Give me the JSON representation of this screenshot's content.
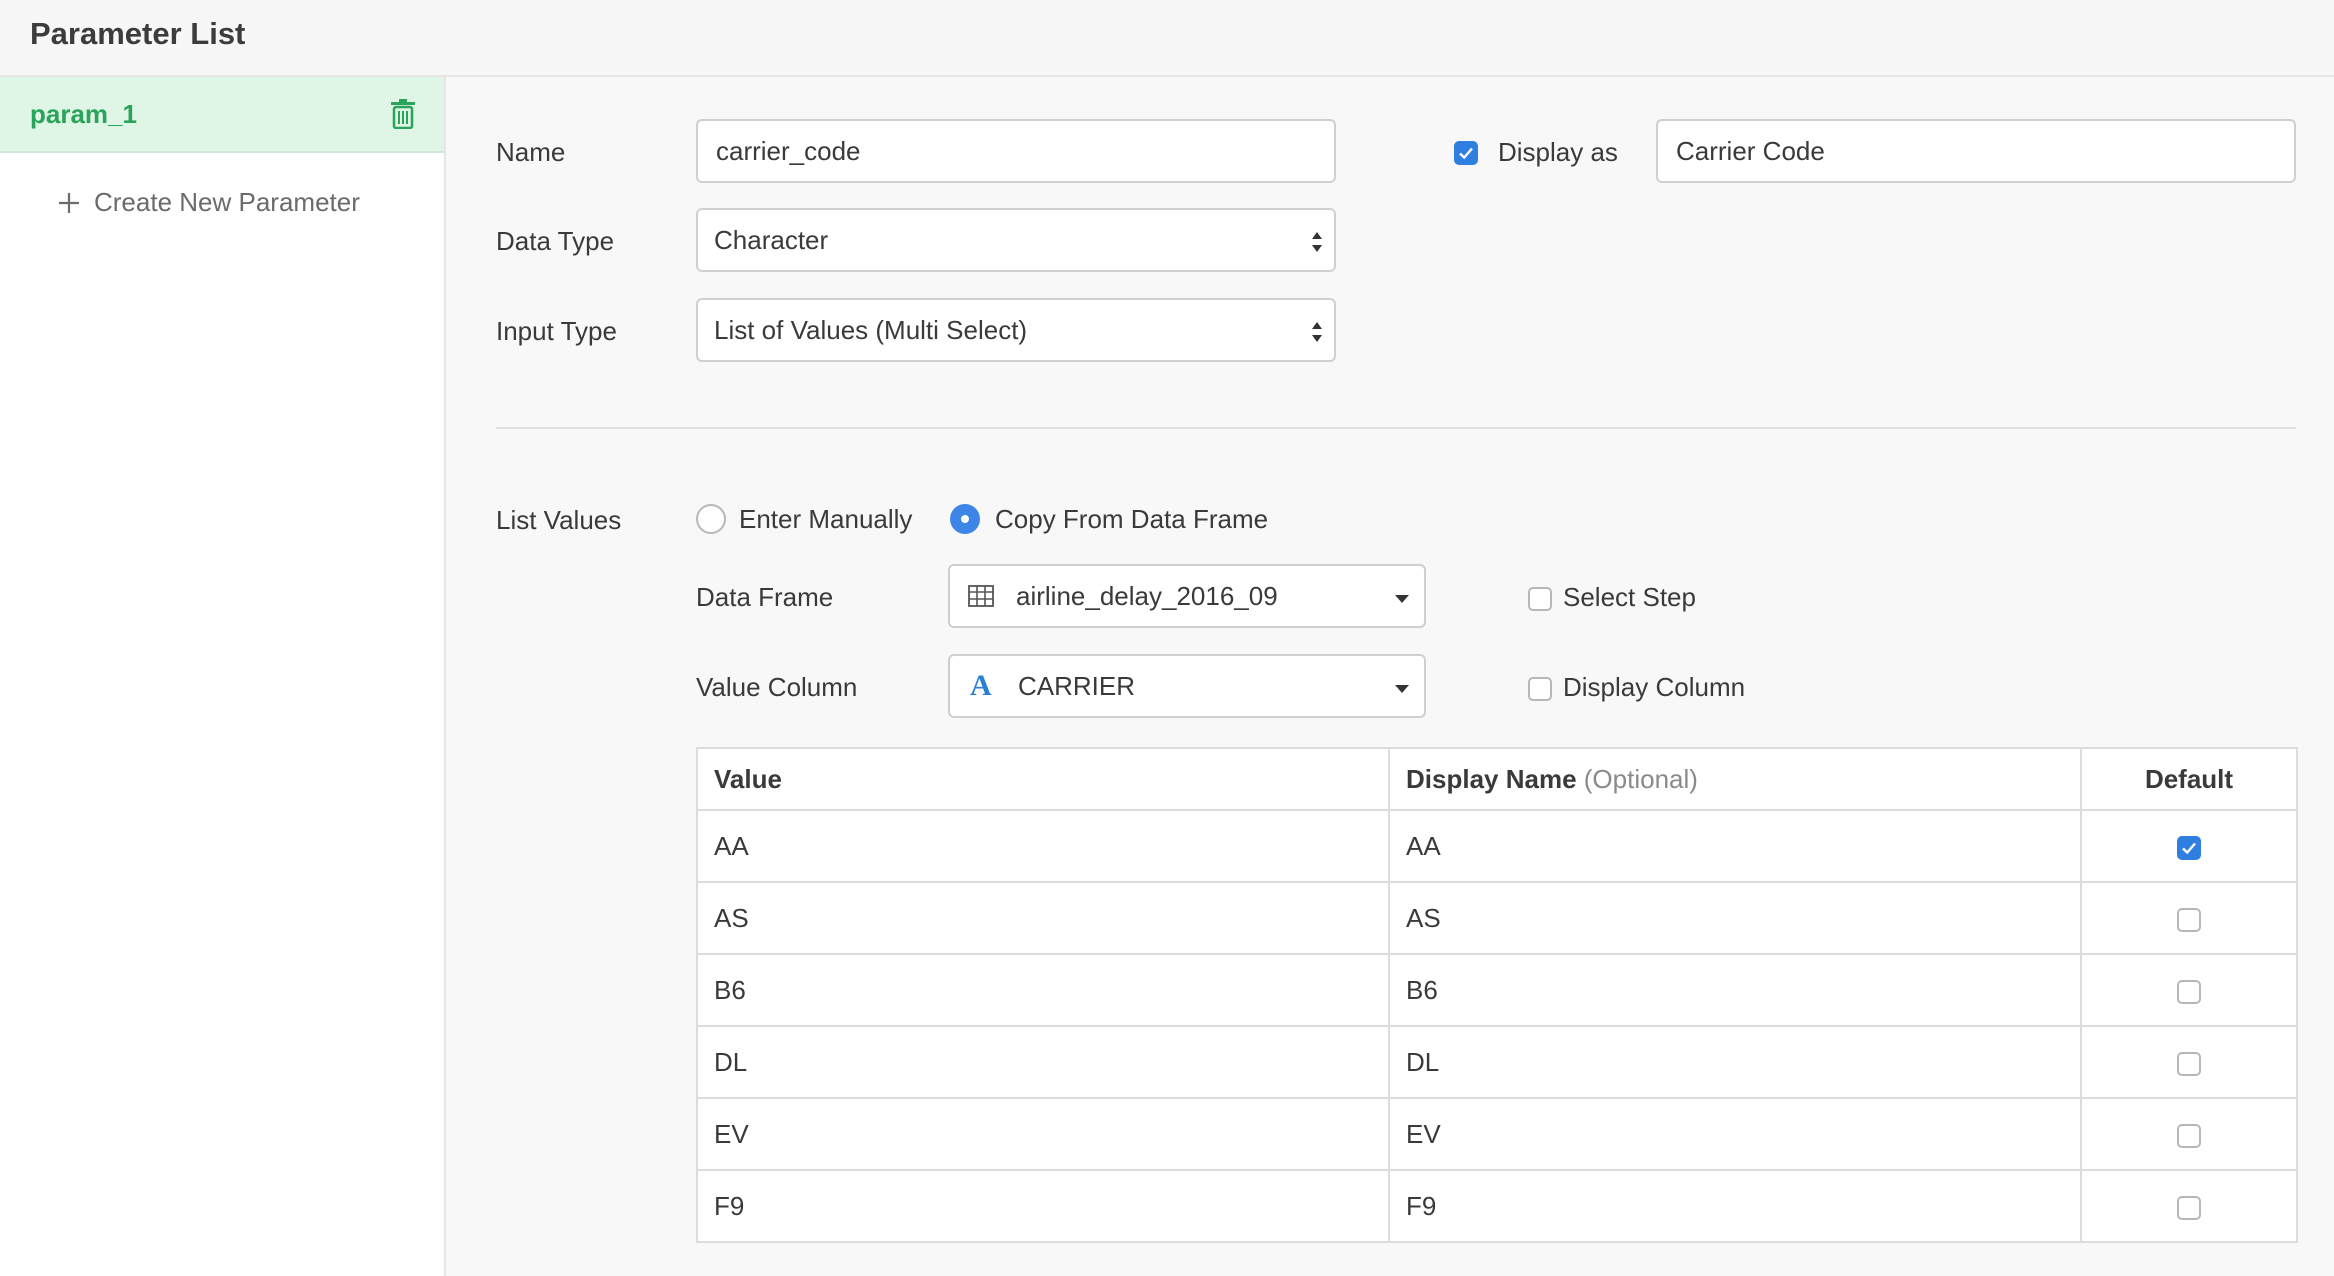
{
  "header": {
    "title": "Parameter List"
  },
  "sidebar": {
    "param_name": "param_1",
    "create_new_label": "Create New Parameter"
  },
  "form": {
    "name_label": "Name",
    "name_value": "carrier_code",
    "display_as_label": "Display as",
    "display_as_checked": true,
    "display_as_value": "Carrier Code",
    "data_type_label": "Data Type",
    "data_type_value": "Character",
    "input_type_label": "Input Type",
    "input_type_value": "List of Values (Multi Select)"
  },
  "list_values": {
    "label": "List Values",
    "option_manual": "Enter Manually",
    "option_copy": "Copy From Data Frame",
    "selected_option": "Copy From Data Frame",
    "data_frame_label": "Data Frame",
    "data_frame_value": "airline_delay_2016_09",
    "select_step_label": "Select Step",
    "value_column_label": "Value Column",
    "value_column_type_glyph": "A",
    "value_column_value": "CARRIER",
    "display_column_label": "Display Column"
  },
  "table": {
    "headers": {
      "value": "Value",
      "display_name": "Display Name",
      "optional": "(Optional)",
      "default": "Default"
    },
    "rows": [
      {
        "value": "AA",
        "display": "AA",
        "default": true
      },
      {
        "value": "AS",
        "display": "AS",
        "default": false
      },
      {
        "value": "B6",
        "display": "B6",
        "default": false
      },
      {
        "value": "DL",
        "display": "DL",
        "default": false
      },
      {
        "value": "EV",
        "display": "EV",
        "default": false
      },
      {
        "value": "F9",
        "display": "F9",
        "default": false
      }
    ]
  },
  "colors": {
    "accent_green": "#2aa45a",
    "selected_bg": "#dff5e5",
    "check_blue": "#2f7fe0",
    "type_icon_blue": "#2a7fd4"
  }
}
